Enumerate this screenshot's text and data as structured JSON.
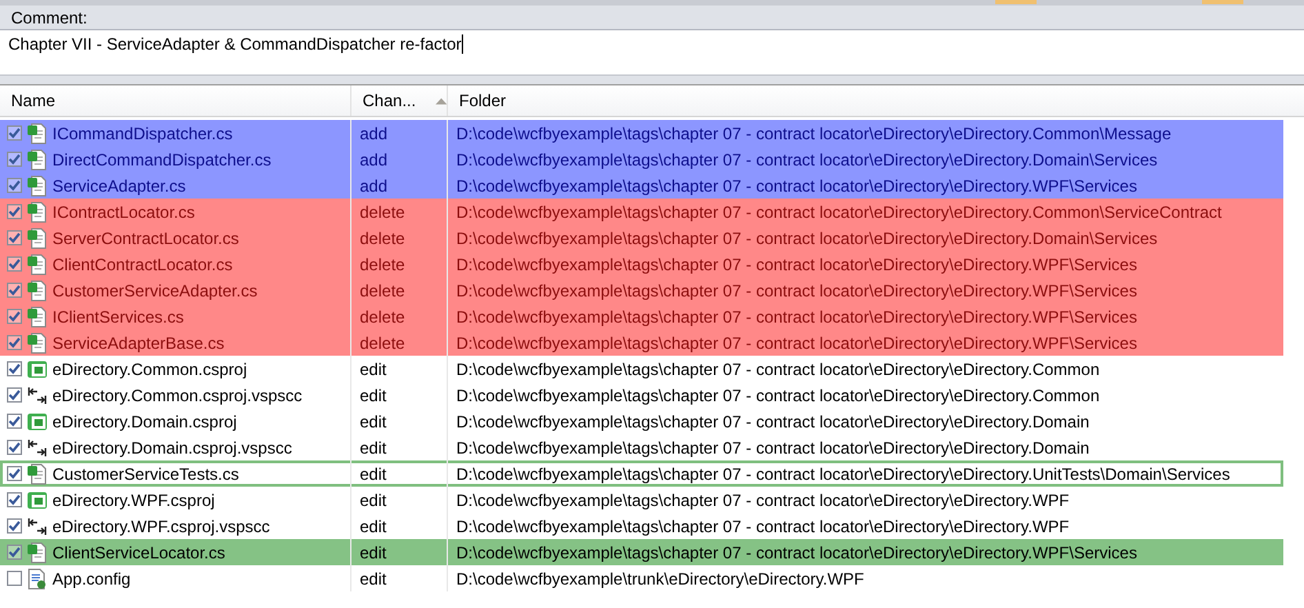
{
  "comment": {
    "label": "Comment:",
    "value": "Chapter VII - ServiceAdapter & CommandDispatcher re-factor"
  },
  "table": {
    "columns": [
      {
        "label": "Name",
        "sorted": false
      },
      {
        "label": "Chan...",
        "sorted": true
      },
      {
        "label": "Folder",
        "sorted": false
      }
    ],
    "rows": [
      {
        "kind": "cs",
        "checked": true,
        "selected": false,
        "focused": false,
        "color": "#8c96ff",
        "name": "ICommandDispatcher.cs",
        "change": "add",
        "folder": "D:\\code\\wcfbyexample\\tags\\chapter 07 - contract locator\\eDirectory\\eDirectory.Common\\Message"
      },
      {
        "kind": "cs",
        "checked": true,
        "selected": false,
        "focused": false,
        "color": "#8c96ff",
        "name": "DirectCommandDispatcher.cs",
        "change": "add",
        "folder": "D:\\code\\wcfbyexample\\tags\\chapter 07 - contract locator\\eDirectory\\eDirectory.Domain\\Services"
      },
      {
        "kind": "cs",
        "checked": true,
        "selected": false,
        "focused": false,
        "color": "#8c96ff",
        "name": "ServiceAdapter.cs",
        "change": "add",
        "folder": "D:\\code\\wcfbyexample\\tags\\chapter 07 - contract locator\\eDirectory\\eDirectory.WPF\\Services"
      },
      {
        "kind": "cs",
        "checked": true,
        "selected": false,
        "focused": false,
        "color": "#ff8888",
        "name": "IContractLocator.cs",
        "change": "delete",
        "folder": "D:\\code\\wcfbyexample\\tags\\chapter 07 - contract locator\\eDirectory\\eDirectory.Common\\ServiceContract"
      },
      {
        "kind": "cs",
        "checked": true,
        "selected": false,
        "focused": false,
        "color": "#ff8888",
        "name": "ServerContractLocator.cs",
        "change": "delete",
        "folder": "D:\\code\\wcfbyexample\\tags\\chapter 07 - contract locator\\eDirectory\\eDirectory.Domain\\Services"
      },
      {
        "kind": "cs",
        "checked": true,
        "selected": false,
        "focused": false,
        "color": "#ff8888",
        "name": "ClientContractLocator.cs",
        "change": "delete",
        "folder": "D:\\code\\wcfbyexample\\tags\\chapter 07 - contract locator\\eDirectory\\eDirectory.WPF\\Services"
      },
      {
        "kind": "cs",
        "checked": true,
        "selected": false,
        "focused": false,
        "color": "#ff8888",
        "name": "CustomerServiceAdapter.cs",
        "change": "delete",
        "folder": "D:\\code\\wcfbyexample\\tags\\chapter 07 - contract locator\\eDirectory\\eDirectory.WPF\\Services"
      },
      {
        "kind": "cs",
        "checked": true,
        "selected": false,
        "focused": false,
        "color": "#ff8888",
        "name": "IClientServices.cs",
        "change": "delete",
        "folder": "D:\\code\\wcfbyexample\\tags\\chapter 07 - contract locator\\eDirectory\\eDirectory.WPF\\Services"
      },
      {
        "kind": "cs",
        "checked": true,
        "selected": false,
        "focused": false,
        "color": "#ff8888",
        "name": "ServiceAdapterBase.cs",
        "change": "delete",
        "folder": "D:\\code\\wcfbyexample\\tags\\chapter 07 - contract locator\\eDirectory\\eDirectory.WPF\\Services"
      },
      {
        "kind": "csproj",
        "checked": true,
        "selected": false,
        "focused": false,
        "name": "eDirectory.Common.csproj",
        "change": "edit",
        "folder": "D:\\code\\wcfbyexample\\tags\\chapter 07 - contract locator\\eDirectory\\eDirectory.Common"
      },
      {
        "kind": "vspscc",
        "checked": true,
        "selected": false,
        "focused": false,
        "name": "eDirectory.Common.csproj.vspscc",
        "change": "edit",
        "folder": "D:\\code\\wcfbyexample\\tags\\chapter 07 - contract locator\\eDirectory\\eDirectory.Common"
      },
      {
        "kind": "csproj",
        "checked": true,
        "selected": false,
        "focused": false,
        "name": "eDirectory.Domain.csproj",
        "change": "edit",
        "folder": "D:\\code\\wcfbyexample\\tags\\chapter 07 - contract locator\\eDirectory\\eDirectory.Domain"
      },
      {
        "kind": "vspscc",
        "checked": true,
        "selected": false,
        "focused": false,
        "name": "eDirectory.Domain.csproj.vspscc",
        "change": "edit",
        "folder": "D:\\code\\wcfbyexample\\tags\\chapter 07 - contract locator\\eDirectory\\eDirectory.Domain"
      },
      {
        "kind": "cs",
        "checked": true,
        "selected": false,
        "focused": true,
        "name": "CustomerServiceTests.cs",
        "change": "edit",
        "folder": "D:\\code\\wcfbyexample\\tags\\chapter 07 - contract locator\\eDirectory\\eDirectory.UnitTests\\Domain\\Services"
      },
      {
        "kind": "csproj",
        "checked": true,
        "selected": false,
        "focused": false,
        "name": "eDirectory.WPF.csproj",
        "change": "edit",
        "folder": "D:\\code\\wcfbyexample\\tags\\chapter 07 - contract locator\\eDirectory\\eDirectory.WPF"
      },
      {
        "kind": "vspscc",
        "checked": true,
        "selected": false,
        "focused": false,
        "name": "eDirectory.WPF.csproj.vspscc",
        "change": "edit",
        "folder": "D:\\code\\wcfbyexample\\tags\\chapter 07 - contract locator\\eDirectory\\eDirectory.WPF"
      },
      {
        "kind": "cs",
        "checked": true,
        "selected": true,
        "focused": false,
        "name": "ClientServiceLocator.cs",
        "change": "edit",
        "folder": "D:\\code\\wcfbyexample\\tags\\chapter 07 - contract locator\\eDirectory\\eDirectory.WPF\\Services"
      },
      {
        "kind": "config",
        "checked": false,
        "selected": false,
        "focused": false,
        "name": "App.config",
        "change": "edit",
        "folder": "D:\\code\\wcfbyexample\\trunk\\eDirectory\\eDirectory.WPF"
      }
    ]
  }
}
